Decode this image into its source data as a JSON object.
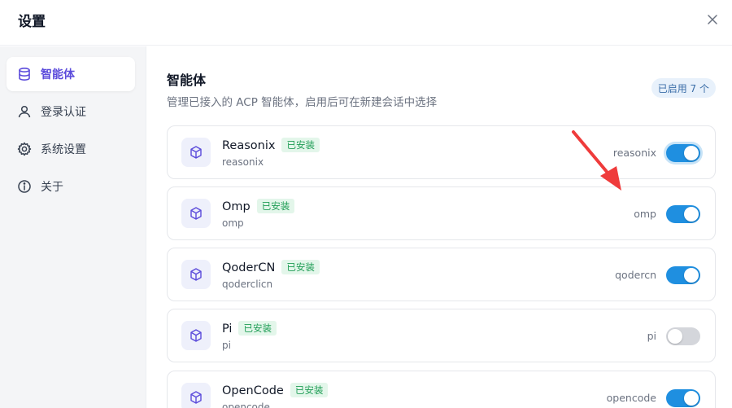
{
  "window": {
    "title": "设置",
    "close_icon": "close-icon"
  },
  "sidebar": {
    "items": [
      {
        "label": "智能体",
        "icon": "database-icon",
        "active": true
      },
      {
        "label": "登录认证",
        "icon": "user-icon",
        "active": false
      },
      {
        "label": "系统设置",
        "icon": "gear-icon",
        "active": false
      },
      {
        "label": "关于",
        "icon": "info-icon",
        "active": false
      }
    ]
  },
  "main": {
    "title": "智能体",
    "description": "管理已接入的 ACP 智能体，启用后可在新建会话中选择",
    "enabled_badge": "已启用 7 个",
    "agents": [
      {
        "name": "Reasonix",
        "status": "已安装",
        "package": "reasonix",
        "command": "reasonix",
        "enabled": true
      },
      {
        "name": "Omp",
        "status": "已安装",
        "package": "omp",
        "command": "omp",
        "enabled": true
      },
      {
        "name": "QoderCN",
        "status": "已安装",
        "package": "qoderclicn",
        "command": "qodercn",
        "enabled": true
      },
      {
        "name": "Pi",
        "status": "已安装",
        "package": "pi",
        "command": "pi",
        "enabled": false
      },
      {
        "name": "OpenCode",
        "status": "已安装",
        "package": "opencode",
        "command": "opencode",
        "enabled": true
      }
    ]
  },
  "colors": {
    "accent": "#5b4bdb",
    "toggle_on": "#1f8fe0",
    "installed": "#1f9d55",
    "arrow": "#ef3b3b"
  }
}
